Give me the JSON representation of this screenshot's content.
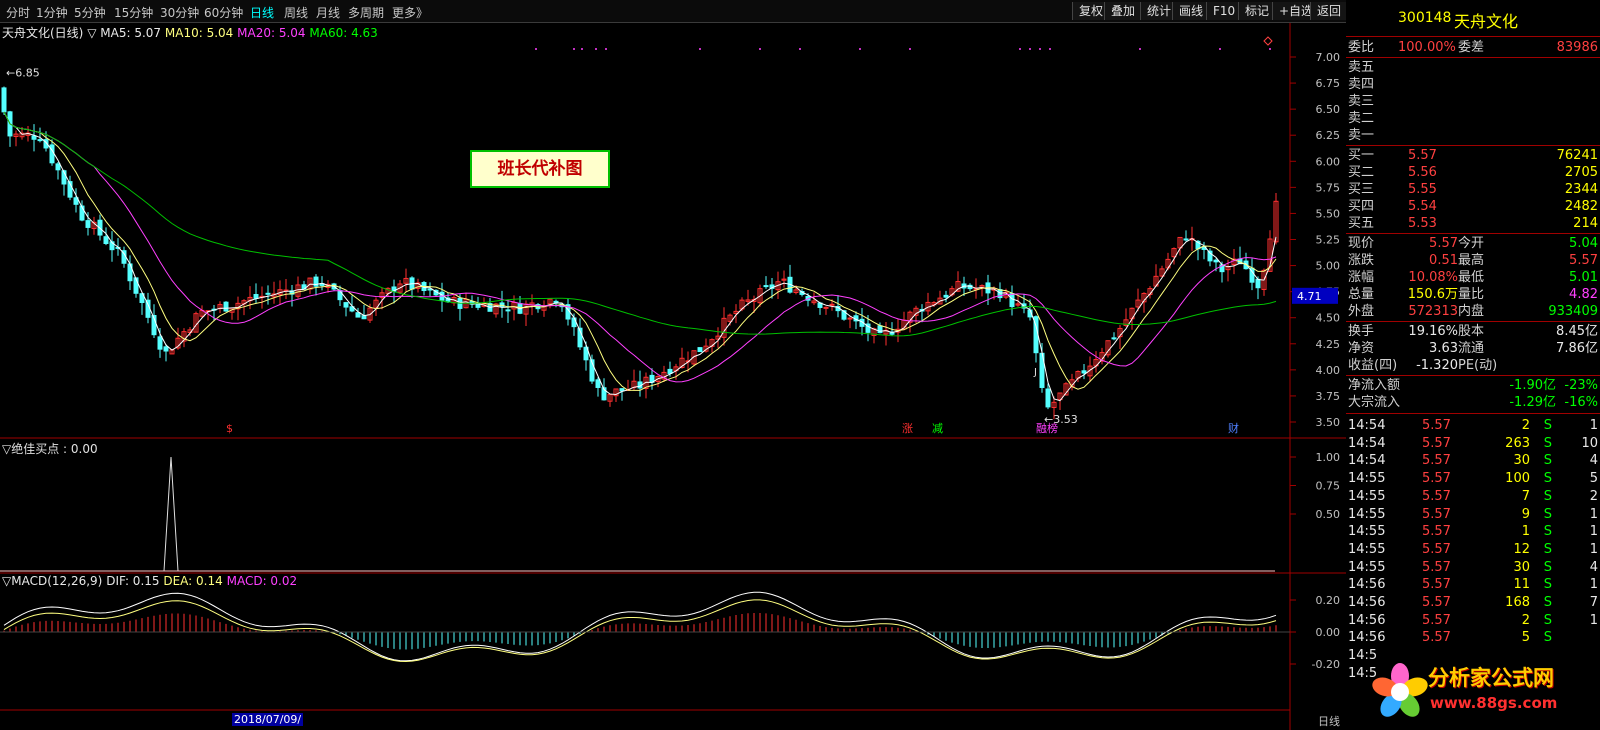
{
  "toolbar": {
    "periods": [
      "分时",
      "1分钟",
      "5分钟",
      "15分钟",
      "30分钟",
      "60分钟",
      "日线",
      "周线",
      "月线",
      "多周期",
      "更多》"
    ],
    "active_period": "日线",
    "tools": [
      "复权",
      "叠加",
      "统计",
      "画线",
      "F10",
      "标记",
      "+自选",
      "返回"
    ]
  },
  "main_chart": {
    "legend": {
      "name": "天舟文化(日线)",
      "ma5": "MA5: 5.07",
      "ma10": "MA10: 5.04",
      "ma20": "MA20: 5.04",
      "ma60": "MA60: 4.63"
    },
    "y_ticks": [
      "7.00",
      "6.75",
      "6.50",
      "6.25",
      "6.00",
      "5.75",
      "5.50",
      "5.25",
      "5.00",
      "4.75",
      "4.50",
      "4.25",
      "4.00",
      "3.75",
      "3.50"
    ],
    "high_marker": "6.85",
    "low_marker": "3.53",
    "current_price_tag": "4.71",
    "annotation": "班长代补图",
    "event_marks": [
      "$",
      "涨",
      "减",
      "融榜",
      "财"
    ],
    "j_mark": "J"
  },
  "indicator_panel": {
    "title": "▽绝佳买点 : 0.00",
    "y_ticks": [
      "1.00",
      "0.75",
      "0.50"
    ]
  },
  "macd_panel": {
    "title": "▽MACD(12,26,9)",
    "dif": "DIF: 0.15",
    "dea": "DEA: 0.14",
    "macd": "MACD: 0.02",
    "y_ticks": [
      "0.20",
      "0.00",
      "-0.20"
    ]
  },
  "bottom_axis": {
    "date_label": "2018/07/09/",
    "corner_label": "日线"
  },
  "quote": {
    "code": "300148",
    "name": "天舟文化",
    "weibi_label": "委比",
    "weibi": "100.00%",
    "weicha_label": "委差",
    "weicha": "83986",
    "sell": [
      {
        "label": "卖五",
        "price": "",
        "vol": ""
      },
      {
        "label": "卖四",
        "price": "",
        "vol": ""
      },
      {
        "label": "卖三",
        "price": "",
        "vol": ""
      },
      {
        "label": "卖二",
        "price": "",
        "vol": ""
      },
      {
        "label": "卖一",
        "price": "",
        "vol": ""
      }
    ],
    "buy": [
      {
        "label": "买一",
        "price": "5.57",
        "vol": "76241"
      },
      {
        "label": "买二",
        "price": "5.56",
        "vol": "2705"
      },
      {
        "label": "买三",
        "price": "5.55",
        "vol": "2344"
      },
      {
        "label": "买四",
        "price": "5.54",
        "vol": "2482"
      },
      {
        "label": "买五",
        "price": "5.53",
        "vol": "214"
      }
    ],
    "stats": [
      {
        "l1": "现价",
        "v1": "5.57",
        "l2": "今开",
        "v2": "5.04",
        "c1": "red",
        "c2": "grn"
      },
      {
        "l1": "涨跌",
        "v1": "0.51",
        "l2": "最高",
        "v2": "5.57",
        "c1": "red",
        "c2": "red"
      },
      {
        "l1": "涨幅",
        "v1": "10.08%",
        "l2": "最低",
        "v2": "5.01",
        "c1": "red",
        "c2": "grn"
      },
      {
        "l1": "总量",
        "v1": "150.6万",
        "l2": "量比",
        "v2": "4.82",
        "c1": "yel",
        "c2": "mag"
      },
      {
        "l1": "外盘",
        "v1": "572313",
        "l2": "内盘",
        "v2": "933409",
        "c1": "red",
        "c2": "grn"
      }
    ],
    "stats2": [
      {
        "l1": "换手",
        "v1": "19.16%",
        "l2": "股本",
        "v2": "8.45亿"
      },
      {
        "l1": "净资",
        "v1": "3.63",
        "l2": "流通",
        "v2": "7.86亿"
      },
      {
        "l1": "收益(四)",
        "v1": "-1.320",
        "l2": "PE(动)",
        "v2": ""
      }
    ],
    "flows": [
      {
        "label": "净流入额",
        "value": "-1.90亿",
        "pct": "-23%"
      },
      {
        "label": "大宗流入",
        "value": "-1.29亿",
        "pct": "-16%"
      }
    ]
  },
  "ticks": [
    {
      "time": "14:54",
      "price": "5.57",
      "vol": "2",
      "side": "S",
      "n": "1"
    },
    {
      "time": "14:54",
      "price": "5.57",
      "vol": "263",
      "side": "S",
      "n": "10"
    },
    {
      "time": "14:54",
      "price": "5.57",
      "vol": "30",
      "side": "S",
      "n": "4"
    },
    {
      "time": "14:55",
      "price": "5.57",
      "vol": "100",
      "side": "S",
      "n": "5"
    },
    {
      "time": "14:55",
      "price": "5.57",
      "vol": "7",
      "side": "S",
      "n": "2"
    },
    {
      "time": "14:55",
      "price": "5.57",
      "vol": "9",
      "side": "S",
      "n": "1"
    },
    {
      "time": "14:55",
      "price": "5.57",
      "vol": "1",
      "side": "S",
      "n": "1"
    },
    {
      "time": "14:55",
      "price": "5.57",
      "vol": "12",
      "side": "S",
      "n": "1"
    },
    {
      "time": "14:55",
      "price": "5.57",
      "vol": "30",
      "side": "S",
      "n": "4"
    },
    {
      "time": "14:56",
      "price": "5.57",
      "vol": "11",
      "side": "S",
      "n": "1"
    },
    {
      "time": "14:56",
      "price": "5.57",
      "vol": "168",
      "side": "S",
      "n": "7"
    },
    {
      "time": "14:56",
      "price": "5.57",
      "vol": "2",
      "side": "S",
      "n": "1"
    },
    {
      "time": "14:56",
      "price": "5.57",
      "vol": "5",
      "side": "S",
      "n": ""
    },
    {
      "time": "14:5",
      "price": "",
      "vol": "",
      "side": "",
      "n": ""
    },
    {
      "time": "14:5",
      "price": "",
      "vol": "",
      "side": "",
      "n": ""
    }
  ],
  "watermark": {
    "name": "分析家公式网",
    "url": "www.88gs.com"
  },
  "colors": {
    "up": "#ff3030",
    "down": "#54ffff",
    "ma5": "#ffffff",
    "ma10": "#ffff80",
    "ma20": "#ff40ff",
    "ma60": "#00c000",
    "frame": "#a00000"
  }
}
